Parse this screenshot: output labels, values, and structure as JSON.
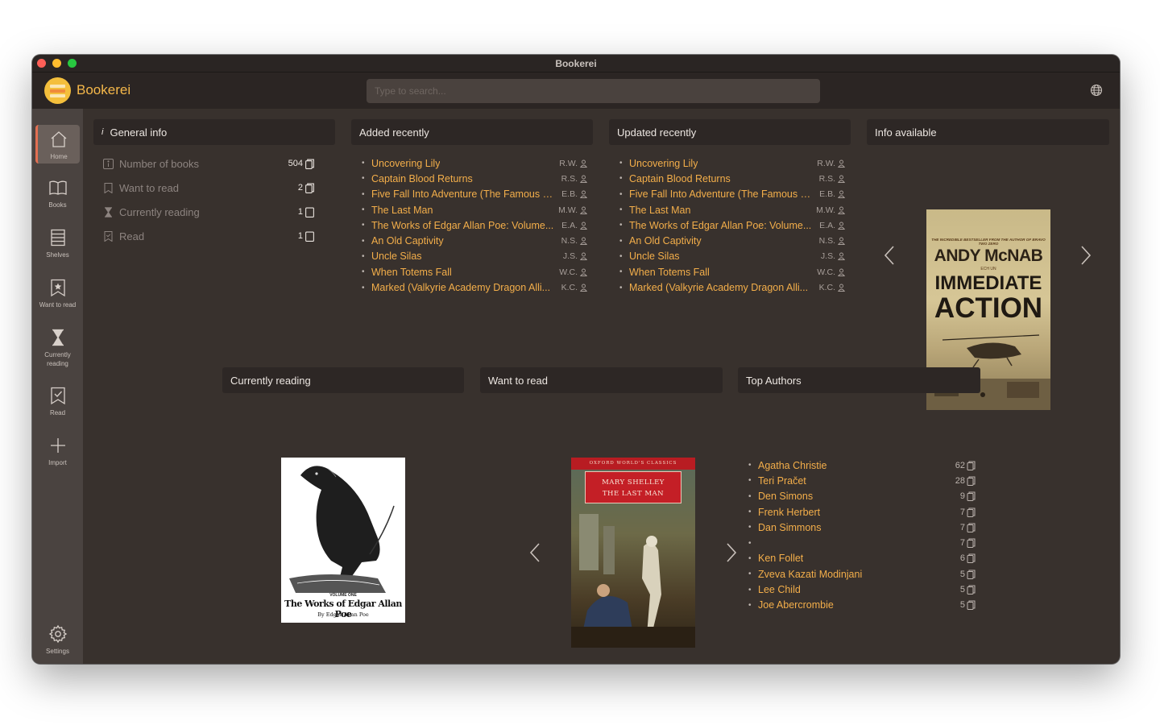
{
  "window": {
    "title": "Bookerei"
  },
  "header": {
    "app_name": "Bookerei",
    "search_placeholder": "Type to search..."
  },
  "sidebar": {
    "items": [
      {
        "label": "Home",
        "icon": "home-icon"
      },
      {
        "label": "Books",
        "icon": "book-icon"
      },
      {
        "label": "Shelves",
        "icon": "shelves-icon"
      },
      {
        "label": "Want to read",
        "icon": "bookmark-star-icon"
      },
      {
        "label": "Currently reading",
        "icon": "hourglass-icon"
      },
      {
        "label": "Read",
        "icon": "bookmark-check-icon"
      },
      {
        "label": "Import",
        "icon": "plus-icon"
      }
    ],
    "settings_label": "Settings",
    "active": "Home"
  },
  "general_info": {
    "title": "General info",
    "rows": [
      {
        "label": "Number of books",
        "value": "504"
      },
      {
        "label": "Want to read",
        "value": "2"
      },
      {
        "label": "Currently reading",
        "value": "1"
      },
      {
        "label": "Read",
        "value": "1"
      }
    ]
  },
  "added_recently": {
    "title": "Added recently",
    "items": [
      {
        "title": "Uncovering Lily",
        "initials": "R.W."
      },
      {
        "title": "Captain Blood Returns",
        "initials": "R.S."
      },
      {
        "title": "Five Fall Into Adventure (The Famous F...",
        "initials": "E.B."
      },
      {
        "title": "The Last Man",
        "initials": "M.W."
      },
      {
        "title": "The Works of Edgar Allan Poe: Volume...",
        "initials": "E.A."
      },
      {
        "title": "An Old Captivity",
        "initials": "N.S."
      },
      {
        "title": "Uncle Silas",
        "initials": "J.S."
      },
      {
        "title": "When Totems Fall",
        "initials": "W.C."
      },
      {
        "title": "Marked (Valkyrie Academy Dragon Alli...",
        "initials": "K.C."
      }
    ]
  },
  "updated_recently": {
    "title": "Updated recently",
    "items": [
      {
        "title": "Uncovering Lily",
        "initials": "R.W."
      },
      {
        "title": "Captain Blood Returns",
        "initials": "R.S."
      },
      {
        "title": "Five Fall Into Adventure (The Famous F...",
        "initials": "E.B."
      },
      {
        "title": "The Last Man",
        "initials": "M.W."
      },
      {
        "title": "The Works of Edgar Allan Poe: Volume...",
        "initials": "E.A."
      },
      {
        "title": "An Old Captivity",
        "initials": "N.S."
      },
      {
        "title": "Uncle Silas",
        "initials": "J.S."
      },
      {
        "title": "When Totems Fall",
        "initials": "W.C."
      },
      {
        "title": "Marked (Valkyrie Academy Dragon Alli...",
        "initials": "K.C."
      }
    ]
  },
  "info_available": {
    "title": "Info available",
    "cover": {
      "tagline": "THE INCREDIBLE BESTSELLER FROM THE AUTHOR OF BRAVO TWO ZERO",
      "author": "ANDY McNAB",
      "subtitle": "ECH UN",
      "title_line1": "IMMEDIATE",
      "title_line2": "ACTION"
    }
  },
  "currently_reading": {
    "title": "Currently reading",
    "cover": {
      "volume": "VOLUME ONE",
      "title": "The Works of Edgar Allan Poe",
      "byline": "By Edgar Allan Poe"
    }
  },
  "want_to_read": {
    "title": "Want to read",
    "cover": {
      "series": "OXFORD WORLD'S CLASSICS",
      "author": "MARY SHELLEY",
      "title": "THE LAST MAN"
    }
  },
  "top_authors": {
    "title": "Top Authors",
    "items": [
      {
        "name": "Agatha Christie",
        "count": "62"
      },
      {
        "name": "Teri Pračet",
        "count": "28"
      },
      {
        "name": "Den Simons",
        "count": "9"
      },
      {
        "name": "Frenk Herbert",
        "count": "7"
      },
      {
        "name": "Dan Simmons",
        "count": "7"
      },
      {
        "name": "",
        "count": "7"
      },
      {
        "name": "Ken Follet",
        "count": "6"
      },
      {
        "name": "Zveva Kazati Modinjani",
        "count": "5"
      },
      {
        "name": "Lee Child",
        "count": "5"
      },
      {
        "name": "Joe Abercrombie",
        "count": "5"
      }
    ]
  },
  "colors": {
    "accent": "#f3ae4a",
    "active_border": "#e36f52",
    "panel_bg": "#38312d"
  }
}
